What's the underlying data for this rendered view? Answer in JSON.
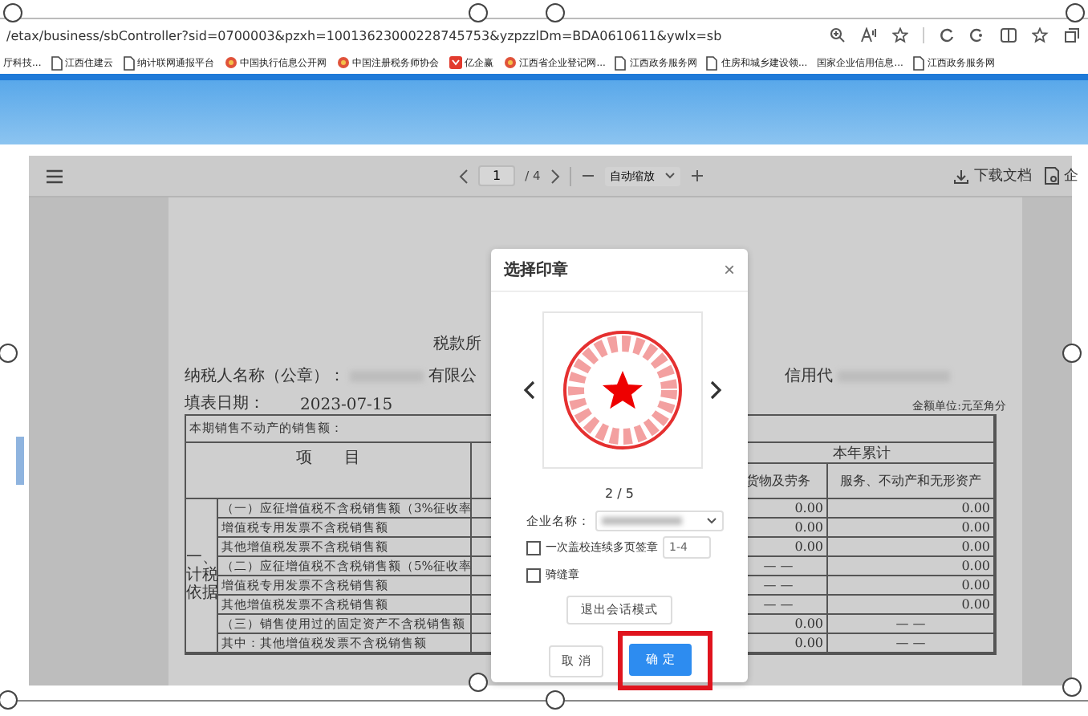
{
  "browser": {
    "url": "/etax/business/sbController?sid=0700003&pzxh=10013623000228745753&yzpzzlDm=BDA0610611&ywlx=sb",
    "bookmarks": [
      {
        "label": "厅科技...",
        "kind": "none"
      },
      {
        "label": "江西住建云",
        "kind": "page"
      },
      {
        "label": "纳计联网通报平台",
        "kind": "page"
      },
      {
        "label": "中国执行信息公开网",
        "kind": "emblem"
      },
      {
        "label": "中国注册税务师协会",
        "kind": "emblem"
      },
      {
        "label": "亿企赢",
        "kind": "app"
      },
      {
        "label": "江西省企业登记网...",
        "kind": "emblem"
      },
      {
        "label": "江西政务服务网",
        "kind": "page"
      },
      {
        "label": "住房和城乡建设领...",
        "kind": "page"
      },
      {
        "label": "国家企业信用信息...",
        "kind": "none"
      },
      {
        "label": "江西政务服务网",
        "kind": "page"
      }
    ]
  },
  "pdf_toolbar": {
    "page": "1",
    "page_count": "/ 4",
    "zoom": "自动缩放",
    "download": "下载文档",
    "extra": "企"
  },
  "document": {
    "title": "税款所",
    "taxpayer_label": "纳税人名称（公章）：",
    "taxpayer_suffix": "有限公",
    "credit_label": "信用代",
    "date_label": "填表日期：",
    "date": "2023-07-15",
    "unit": "金额单位:元至角分",
    "section_row": "本期销售不动产的销售额：",
    "group_label": "一、计税依据",
    "item_header": "项　　目",
    "period_header": "本年累计",
    "columns": [
      "货物及劳务",
      "服务、不动产和无形资产"
    ],
    "rows": [
      {
        "item": "（一）应征增值税不含税销售额（3%征收率",
        "values": [
          "0.00",
          "0.00"
        ]
      },
      {
        "item": "增值税专用发票不含税销售额",
        "values": [
          "0.00",
          "0.00"
        ]
      },
      {
        "item": "其他增值税发票不含税销售额",
        "values": [
          "0.00",
          "0.00"
        ]
      },
      {
        "item": "（二）应征增值税不含税销售额（5%征收率",
        "values": [
          "— —",
          "0.00"
        ]
      },
      {
        "item": "增值税专用发票不含税销售额",
        "values": [
          "— —",
          "0.00"
        ]
      },
      {
        "item": "其他增值税发票不含税销售额",
        "values": [
          "— —",
          "0.00"
        ]
      },
      {
        "item": "（三）销售使用过的固定资产不含税销售额",
        "values": [
          "0.00",
          "— —"
        ]
      },
      {
        "item": "其中：其他增值税发票不含税销售额",
        "values": [
          "0.00",
          "— —"
        ]
      }
    ]
  },
  "dialog": {
    "title": "选择印章",
    "close": "×",
    "counter": "2 / 5",
    "company_label": "企业名称：",
    "multi_page": {
      "label": "一次盖校连续多页签章",
      "checked": false,
      "value": "1-4"
    },
    "seam": {
      "label": "骑缝章",
      "checked": false
    },
    "exit_button": "退出会话模式",
    "cancel": "取 消",
    "confirm": "确 定",
    "confirm_highlighted": true
  }
}
